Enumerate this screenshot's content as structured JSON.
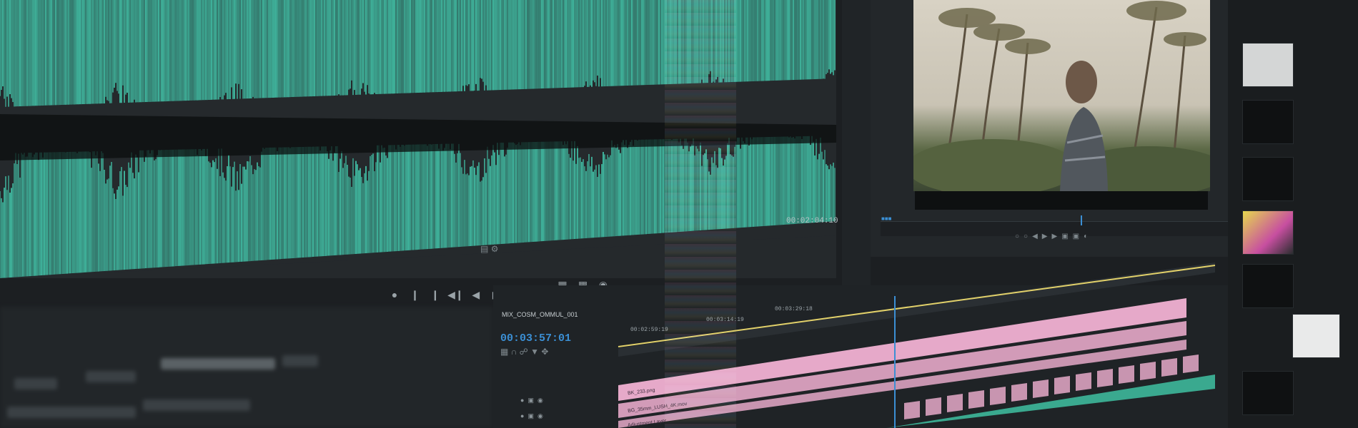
{
  "source_monitor": {
    "timecode": "00:02:04:10",
    "wave_color": "#3fb19a",
    "tools": [
      "marker-icon",
      "settings-icon"
    ]
  },
  "program_monitor": {
    "scene": "person-walking-among-palm-trees",
    "playhead_color": "#3b8fd4"
  },
  "transport": {
    "buttons": [
      "mark-in-icon",
      "mark-out-icon",
      "go-to-in-icon",
      "step-back-icon",
      "play-icon",
      "step-forward-icon",
      "go-to-out-icon",
      "insert-icon",
      "overwrite-icon",
      "export-frame-icon"
    ]
  },
  "sequence": {
    "tab_label": "MIX_COSM_OMMUL_001",
    "timecode": "00:03:57:01",
    "ruler_ticks": [
      "00:02:59:19",
      "00:03:14:19",
      "00:03:29:18"
    ],
    "tools": [
      "nest-icon",
      "snap-icon",
      "link-icon",
      "marker-icon",
      "wrench-icon"
    ]
  },
  "timeline": {
    "track_clips": [
      {
        "label": "BK_233.png"
      },
      {
        "label": "BG_35mm_LUSH_4K.mov"
      },
      {
        "label": "Adjustment Layer"
      }
    ],
    "clip_color": "#e6a9c9",
    "audio_color": "#3aa98f",
    "work_area_color": "#e2d16a"
  }
}
